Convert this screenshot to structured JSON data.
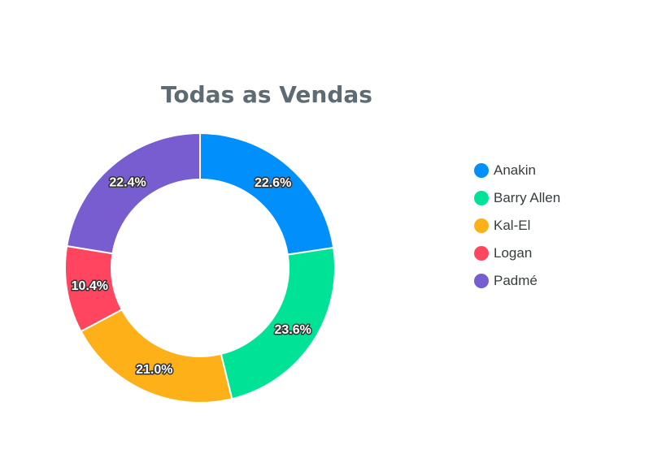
{
  "chart_data": {
    "type": "pie",
    "variant": "donut",
    "title": "Todas as Vendas",
    "categories": [
      "Anakin",
      "Barry Allen",
      "Kal-El",
      "Logan",
      "Padmé"
    ],
    "values": [
      22.6,
      23.6,
      21.0,
      10.4,
      22.4
    ],
    "data_labels": [
      "22.6%",
      "23.6%",
      "21.0%",
      "10.4%",
      "22.4%"
    ],
    "colors": [
      "#008ffb",
      "#00e396",
      "#feb019",
      "#ff4560",
      "#775dd0"
    ],
    "legend_position": "right"
  }
}
